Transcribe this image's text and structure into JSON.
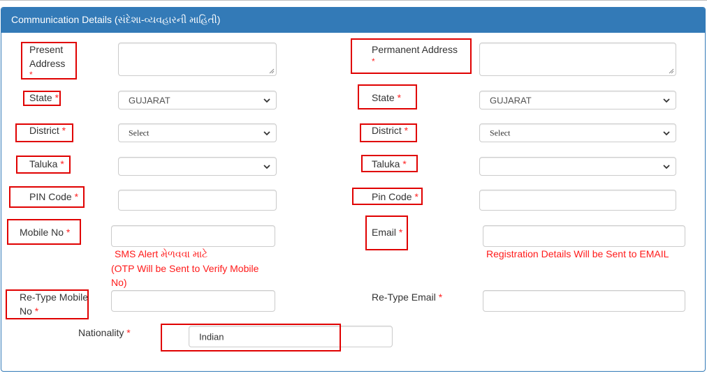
{
  "panel": {
    "title": "Communication Details (સંદેશા-વ્યવહારની માહિતી)"
  },
  "required_marker": "*",
  "left": {
    "present_address": {
      "label_line1": "Present",
      "label_line2": "Address",
      "value": ""
    },
    "state": {
      "label": "State",
      "selected": "GUJARAT"
    },
    "district": {
      "label": "District",
      "selected": "Select"
    },
    "taluka": {
      "label": "Taluka",
      "selected": ""
    },
    "pin_code": {
      "label": "PIN Code",
      "value": ""
    },
    "mobile_no": {
      "label": "Mobile No",
      "value": "",
      "hint_line1": "SMS Alert મેળવવા માટે",
      "hint_line2": "(OTP Will be Sent to Verify Mobile",
      "hint_line3": "No)"
    },
    "retype_mobile": {
      "label_line1": "Re-Type Mobile",
      "label_line2": "No",
      "value": ""
    },
    "nationality": {
      "label": "Nationality",
      "value": "Indian"
    }
  },
  "right": {
    "permanent_address": {
      "label": "Permanent Address",
      "value": ""
    },
    "state": {
      "label": "State",
      "selected": "GUJARAT"
    },
    "district": {
      "label": "District",
      "selected": "Select"
    },
    "taluka": {
      "label": "Taluka",
      "selected": ""
    },
    "pin_code": {
      "label": "Pin Code",
      "value": ""
    },
    "email": {
      "label": "Email",
      "value": "",
      "hint": "Registration Details Will be Sent to EMAIL"
    },
    "retype_email": {
      "label": "Re-Type Email",
      "value": ""
    }
  },
  "colors": {
    "header": "#337ab7",
    "highlight_box": "#e00000",
    "required": "#ff2222",
    "hint_text": "#ff1a1a"
  }
}
